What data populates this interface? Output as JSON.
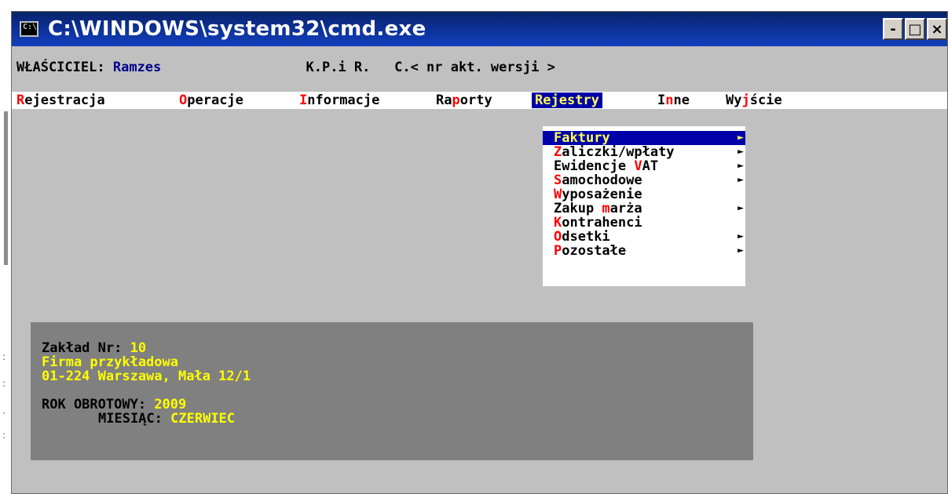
{
  "window": {
    "title": "C:\\WINDOWS\\system32\\cmd.exe",
    "icon_label": "C:\\",
    "minimize_label": "-",
    "maximize_label": "□",
    "close_label": "×"
  },
  "header": {
    "owner_label": "WŁAŚCICIEL:",
    "owner_name": "Ramzes",
    "program": "K.P.i R.",
    "version": "C.< nr akt. wersji >"
  },
  "menu": {
    "items": [
      {
        "hotkey": "R",
        "rest": "ejestracja",
        "pre": ""
      },
      {
        "hotkey": "O",
        "rest": "peracje",
        "pre": ""
      },
      {
        "hotkey": "I",
        "rest": "nformacje",
        "pre": ""
      },
      {
        "pre": "Ra",
        "hotkey": "p",
        "rest": "orty"
      },
      {
        "hotkey": "R",
        "rest": "ejestry",
        "pre": "",
        "active": true
      },
      {
        "pre": "I",
        "hotkey": "n",
        "rest": "ne"
      },
      {
        "pre": "Wy",
        "hotkey": "j",
        "rest": "ście"
      }
    ]
  },
  "dropdown": {
    "arrow_glyph": "►",
    "items": [
      {
        "pre": "",
        "hotkey": "F",
        "rest": "aktury",
        "submenu": true,
        "selected": true
      },
      {
        "pre": "",
        "hotkey": "Z",
        "rest": "aliczki/wpłaty",
        "submenu": true
      },
      {
        "pre": "Ewidencje ",
        "hotkey": "V",
        "rest": "AT",
        "submenu": true
      },
      {
        "pre": "",
        "hotkey": "S",
        "rest": "amochodowe",
        "submenu": true
      },
      {
        "pre": "",
        "hotkey": "W",
        "rest": "yposażenie",
        "submenu": false
      },
      {
        "pre": "Zakup ",
        "hotkey": "m",
        "rest": "arża",
        "submenu": true
      },
      {
        "pre": "",
        "hotkey": "K",
        "rest": "ontrahenci",
        "submenu": false
      },
      {
        "pre": "",
        "hotkey": "O",
        "rest": "dsetki",
        "submenu": true
      },
      {
        "pre": "",
        "hotkey": "P",
        "rest": "ozostałe",
        "submenu": true
      }
    ]
  },
  "company": {
    "plant_label": "Zakład Nr:",
    "plant_number": "10",
    "name": "Firma przykładowa",
    "address": "01-224 Warszawa, Mała 12/1",
    "fiscal_year_label": "ROK OBROTOWY:",
    "fiscal_year": "2009",
    "month_label": "MIESIĄC:",
    "month": "CZERWIEC"
  },
  "colors": {
    "console_bg": "#c0c0c0",
    "menu_bg": "#ffffff",
    "hotkey": "#ff0000",
    "highlight_bg": "#0000aa",
    "highlight_fg": "#ffff55",
    "infobox_bg": "#808080",
    "value_yellow": "#ffff00"
  }
}
